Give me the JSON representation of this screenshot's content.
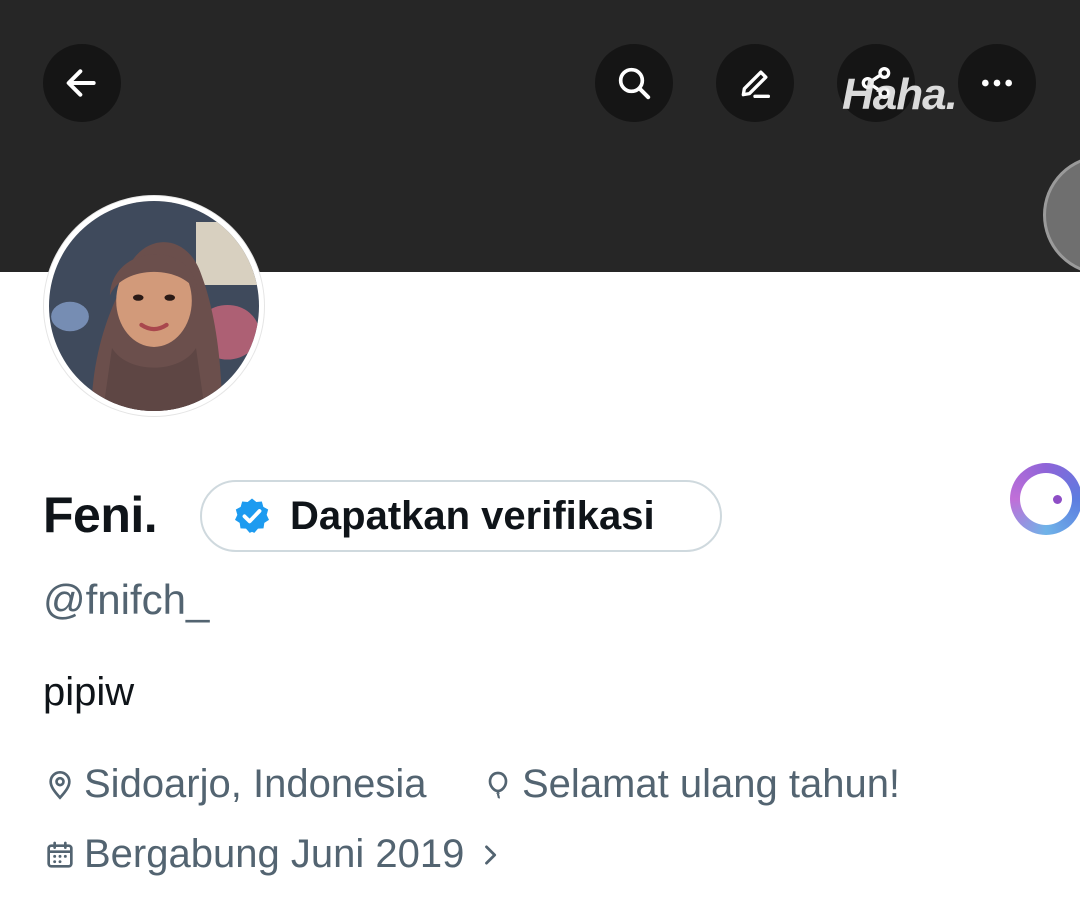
{
  "header": {
    "buttons": [
      {
        "icon": "back-arrow-icon"
      },
      {
        "icon": "search-icon"
      },
      {
        "icon": "edit-pencil-icon"
      },
      {
        "icon": "share-icon"
      },
      {
        "icon": "more-dots-icon"
      }
    ],
    "watermark": "Haha."
  },
  "profile": {
    "name": "Feni.",
    "verify_button": "Dapatkan verifikasi",
    "handle": "@fnifch_",
    "bio": "pipiw",
    "location": "Sidoarjo, Indonesia",
    "birthday": "Selamat ulang tahun!",
    "joined": "Bergabung Juni 2019"
  },
  "colors": {
    "banner": "#262626",
    "text_primary": "#0f1419",
    "text_secondary": "#536471",
    "verified_blue": "#1d9bf0",
    "pill_border": "#cfd9de"
  }
}
